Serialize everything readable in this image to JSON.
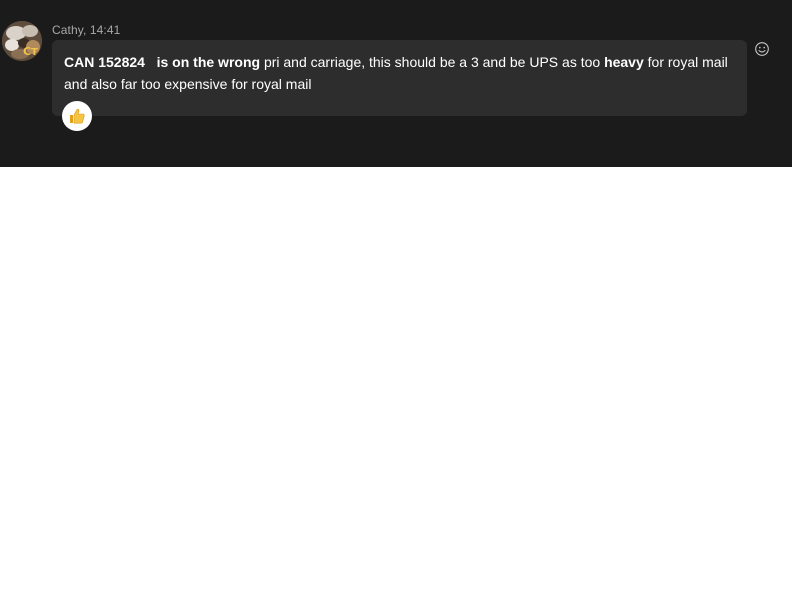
{
  "message": {
    "sender": "Cathy",
    "time": "14:41",
    "meta_separator": ", ",
    "text_parts": {
      "p1": "CAN 152824",
      "p2": "   ",
      "p3": "is on the wrong",
      "p4": " pri and carriage, this should be a 3 and be UPS as too ",
      "p5": "heavy",
      "p6": " for royal mail and also far too expensive for royal mail"
    }
  },
  "reactions": [
    {
      "icon": "thumbs-up-icon",
      "count": ""
    }
  ],
  "actions": {
    "add_reaction_icon": "smiley-icon"
  },
  "colors": {
    "panel_bg": "#1b1b1b",
    "bubble_bg": "#2d2d2d",
    "meta_text": "#a8a8a8",
    "message_text": "#ffffff"
  }
}
